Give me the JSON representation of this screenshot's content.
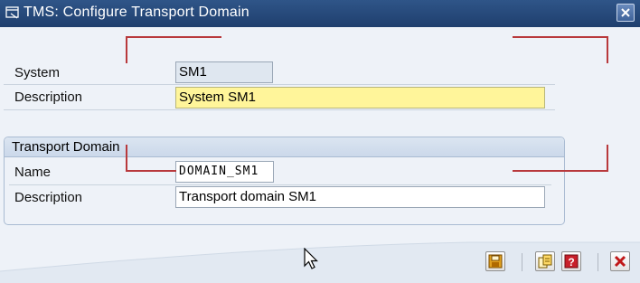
{
  "window": {
    "title": "TMS: Configure Transport Domain"
  },
  "system_section": {
    "system_label": "System",
    "system_value": "SM1",
    "description_label": "Description",
    "description_value": "System SM1"
  },
  "transport_domain": {
    "group_title": "Transport Domain",
    "name_label": "Name",
    "name_value": "DOMAIN_SM1",
    "description_label": "Description",
    "description_value": "Transport domain SM1"
  },
  "colors": {
    "titlebar": "#1f3f6e",
    "required_field": "#fff59a",
    "overlay_lines": "#b8393c"
  },
  "icons": {
    "title": "dialog-window-icon",
    "close": "close-icon",
    "save": "save-icon",
    "copy": "copy-icon",
    "help": "help-icon",
    "cancel": "cancel-icon"
  }
}
